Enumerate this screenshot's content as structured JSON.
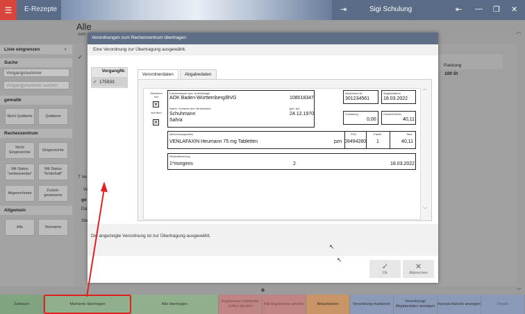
{
  "titlebar": {
    "app_name": "E-Rezepte",
    "user": "Sigi Schulung"
  },
  "background": {
    "page_title": "Alle",
    "page_subtitle": "vom",
    "sidebar": {
      "list_header": "Liste eingrenzen",
      "search_header": "Suche",
      "search_select": "Vorgangsnummer",
      "search_placeholder": "Vorgangsnummer suchen",
      "quit_header": "gematik",
      "quit_buttons": [
        "Nicht Quittierte",
        "Quittierte"
      ],
      "rz_header": "Rechenzentrum",
      "rz_buttons": [
        "Nicht Eingereichte",
        "Eingereichte",
        "Mit Status \"verbesserbar\"",
        "Mit Status \"fehlerhaft\"",
        "Abgerechnete",
        "Zurück-gewiesene"
      ],
      "general_header": "Allgemein",
      "general_buttons": [
        "Alle",
        "Stornierte"
      ]
    },
    "right_column_header": "Packung",
    "right_column_value": "100 St",
    "fragments": [
      "7 Ve",
      "Ve",
      "ge",
      "Da",
      "Sta"
    ]
  },
  "modal": {
    "title": "Verordnungen zum Rechenzentrum übertragen",
    "info": "Eine Verordnung zur Übertragung ausgewählt.",
    "list_header": "VorgangNr.",
    "list_rows": [
      {
        "check": "✓",
        "number": "175933"
      }
    ],
    "tabs": [
      "Verordnerdaten",
      "Abgabedaten"
    ],
    "form": {
      "gebuehr_frei": "Gebühren frei",
      "aut_idem": "aut idem",
      "kk_label": "Krankenkasse bzw. Kostenträger",
      "kk_name": "AOK Baden-Württemberg/BVG",
      "kk_number": "108018347",
      "name_label": "Name, Vorname des Versicherten",
      "surname": "Schuhmann",
      "firstname": "Sahra",
      "geb_label": "geb. am",
      "birthdate": "24.12.1970",
      "apo_label": "Apotheken-Nr.",
      "apo_nr": "301234561",
      "abgabe_label": "Abgabedatum",
      "abgabe_datum": "18.03.2022",
      "zuz_label": "Zuzahlung",
      "zuz_value": "0,00",
      "brutto_label": "Gesamt Brutto",
      "brutto_value": "40,11",
      "abr_label": "Abrechnungszeilen",
      "pzn_col": "PZN",
      "faktor_col": "Faktor",
      "taxe_col": "Taxe",
      "med_name": "VENLAFAXIN Heumann 75 mg Tabletten",
      "pzn_prefix": "pzn",
      "pzn": "09494280",
      "faktor": "1",
      "taxe": "40,11",
      "rz_label": "Rezeptänderung",
      "rz_text": "1*morgens",
      "rz_num": "2",
      "rz_date": "18.03.2022"
    },
    "message": "Die angezeigte Verordnung ist zur Übertragung ausgewählt.",
    "ok_label": "Ok",
    "cancel_label": "Abbrechen"
  },
  "bottombar": [
    {
      "label": "Zeitraum",
      "color": "#7fa47f"
    },
    {
      "label": "Markierte übertragen",
      "color": "#8fb08a"
    },
    {
      "label": "Alle übertragen",
      "color": "#8fb08a"
    },
    {
      "label": "Ergebnisse markierter Zeilen abrufen",
      "color": "#c08484"
    },
    {
      "label": "Alle Ergebnisse abrufen",
      "color": "#c08484"
    },
    {
      "label": "Aktualisieren",
      "color": "#c99466"
    },
    {
      "label": "Verordnung markieren",
      "color": "#8a9ab8"
    },
    {
      "label": "Verordnung/ Abgabedaten anzeigen",
      "color": "#8a9ab8"
    },
    {
      "label": "Rezept-Historie anzeigen",
      "color": "#8a9ab8"
    },
    {
      "label": "Details",
      "color": "#8a9ab8"
    }
  ]
}
